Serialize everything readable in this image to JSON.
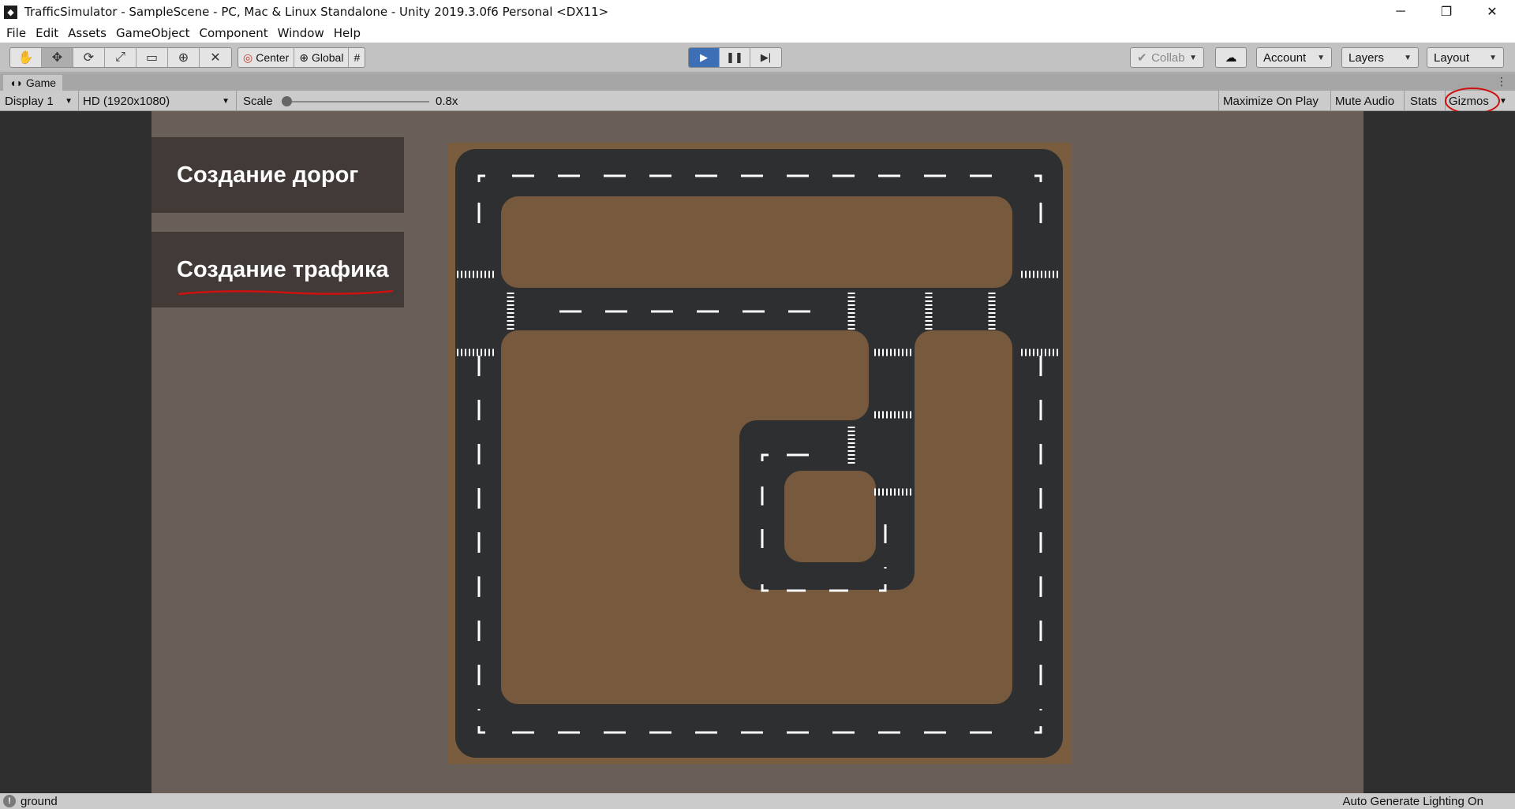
{
  "window": {
    "title": "TrafficSimulator - SampleScene - PC, Mac & Linux Standalone - Unity 2019.3.0f6 Personal <DX11>",
    "minimize": "─",
    "restore": "❐",
    "close": "✕"
  },
  "menu": [
    "File",
    "Edit",
    "Assets",
    "GameObject",
    "Component",
    "Window",
    "Help"
  ],
  "toolbar": {
    "tools": [
      "hand-icon",
      "move-icon",
      "rotate-icon",
      "scale-icon",
      "rect-icon",
      "transform-icon",
      "custom-tool-icon"
    ],
    "pivot": "Center",
    "space": "Global",
    "collab": "Collab",
    "account": "Account",
    "layers": "Layers",
    "layout": "Layout"
  },
  "tab": {
    "label": "Game"
  },
  "gamebar": {
    "display": "Display 1",
    "resolution": "HD (1920x1080)",
    "scale_label": "Scale",
    "scale_value": "0.8x",
    "maximize": "Maximize On Play",
    "mute": "Mute Audio",
    "stats": "Stats",
    "gizmos": "Gizmos"
  },
  "game": {
    "button_roads": "Создание дорог",
    "button_traffic": "Создание трафика"
  },
  "status": {
    "message": "ground",
    "lighting": "Auto Generate Lighting On"
  },
  "colors": {
    "annotation": "#d01010",
    "asphalt": "#2e2f31",
    "ground": "#7a5c3e",
    "play_active": "#3d6fb6"
  }
}
